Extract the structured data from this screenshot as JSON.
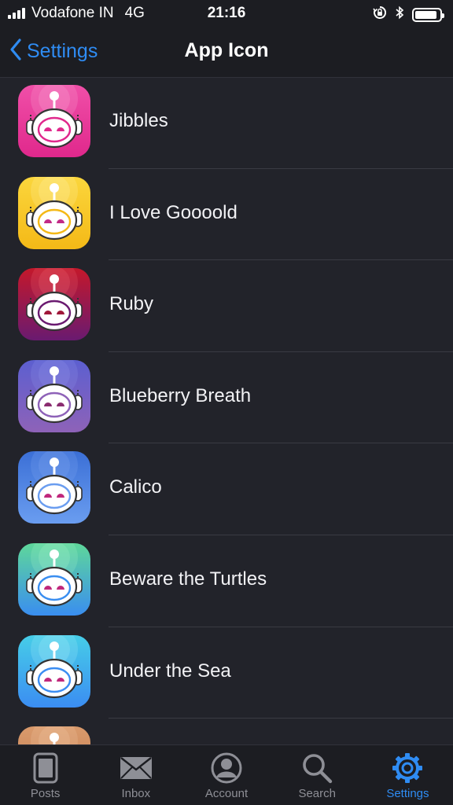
{
  "status_bar": {
    "carrier": "Vodafone IN",
    "network": "4G",
    "time": "21:16",
    "battery_level": 0.9
  },
  "nav": {
    "back_label": "Settings",
    "title": "App Icon"
  },
  "icons": [
    {
      "label": "Jibbles",
      "color_top": "#f04fa8",
      "color_bottom": "#e0288c",
      "ring": "#f8a0d0",
      "ear": "#ffffff",
      "eye": "#e0288c"
    },
    {
      "label": "I Love Goooold",
      "color_top": "#fbd63c",
      "color_bottom": "#f4b917",
      "ring": "#fff0a0",
      "ear": "#ffffff",
      "eye": "#c22a86"
    },
    {
      "label": "Ruby",
      "color_top": "#c4182b",
      "color_bottom": "#6a1a70",
      "ring": "#e85c6a",
      "ear": "#ffffff",
      "eye": "#a0183a"
    },
    {
      "label": "Blueberry Breath",
      "color_top": "#5c5fd0",
      "color_bottom": "#8e62b8",
      "ring": "#8c8ee8",
      "ear": "#ffffff",
      "eye": "#8a2c70"
    },
    {
      "label": "Calico",
      "color_top": "#3b6fd6",
      "color_bottom": "#6a9df0",
      "ring": "#7aa3ee",
      "ear": "#ffffff",
      "eye": "#c0287c"
    },
    {
      "label": "Beware the Turtles",
      "color_top": "#5ed79a",
      "color_bottom": "#3a8ef0",
      "ring": "#9df0c4",
      "ear": "#ffffff",
      "eye": "#c0287c"
    },
    {
      "label": "Under the Sea",
      "color_top": "#46cde8",
      "color_bottom": "#3b8df2",
      "ring": "#9ae8f6",
      "ear": "#ffffff",
      "eye": "#c0287c"
    },
    {
      "label": "",
      "color_top": "#d99a6c",
      "color_bottom": "#c27a4e",
      "ring": "#f0c4a0",
      "ear": "#ffffff",
      "eye": "#c0287c"
    }
  ],
  "tabs": [
    {
      "label": "Posts",
      "icon": "posts-icon",
      "active": false
    },
    {
      "label": "Inbox",
      "icon": "inbox-icon",
      "active": false
    },
    {
      "label": "Account",
      "icon": "account-icon",
      "active": false
    },
    {
      "label": "Search",
      "icon": "search-icon",
      "active": false
    },
    {
      "label": "Settings",
      "icon": "gear-icon",
      "active": true
    }
  ],
  "colors": {
    "accent": "#2f8cf3",
    "background": "#22232a",
    "bar": "#1c1d22"
  }
}
